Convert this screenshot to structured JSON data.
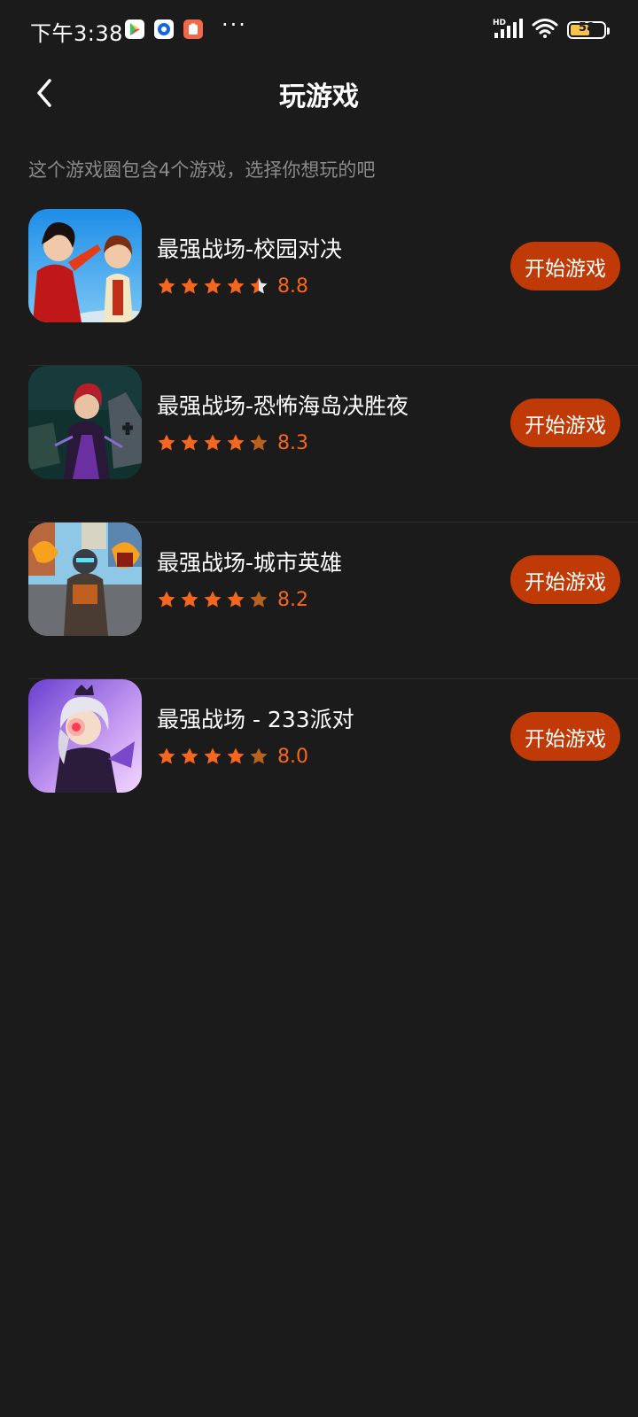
{
  "status_bar": {
    "time": "下午3:38",
    "more": "···",
    "signal_label": "HD",
    "battery_level": "58",
    "battery_fraction": 0.58
  },
  "header": {
    "title": "玩游戏",
    "back_icon": "chevron-left-icon"
  },
  "subtitle": "这个游戏圈包含4个游戏，选择你想玩的吧",
  "colors": {
    "background": "#1b1b1b",
    "accent": "#bf3a06",
    "star_full": "#f5661f",
    "star_dim": "#b8621f",
    "rating_text": "#f5661f"
  },
  "games": [
    {
      "name": "最强战场-校园对决",
      "rating": "8.8",
      "stars": 4.5,
      "play_label": "开始游戏"
    },
    {
      "name": "最强战场-恐怖海岛决胜夜",
      "rating": "8.3",
      "stars": 4.2,
      "play_label": "开始游戏"
    },
    {
      "name": "最强战场-城市英雄",
      "rating": "8.2",
      "stars": 4.1,
      "play_label": "开始游戏"
    },
    {
      "name": "最强战场 - 233派对",
      "rating": "8.0",
      "stars": 4.0,
      "play_label": "开始游戏"
    }
  ]
}
